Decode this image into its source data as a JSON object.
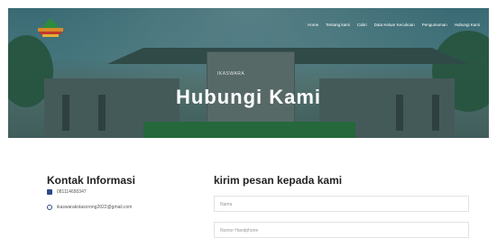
{
  "nav": {
    "items": [
      "Home",
      "Tentang kami",
      "Cabri",
      "Data Keluar Kecukoan",
      "Pengumuman",
      "Hubungi Kami"
    ]
  },
  "hero": {
    "title": "Hubungi Kami",
    "building_sign": "IKASWARA"
  },
  "contact": {
    "title": "Kontak Informasi",
    "phone": "081114650347",
    "email": "ikaswarakotasorong2022@gmail.com"
  },
  "form": {
    "title": "kirim pesan kepada kami",
    "name_placeholder": "Nama",
    "phone_placeholder": "Nomor Handphone"
  },
  "colors": {
    "accent": "#2d4a8a",
    "hero_green": "#2d8a42"
  }
}
